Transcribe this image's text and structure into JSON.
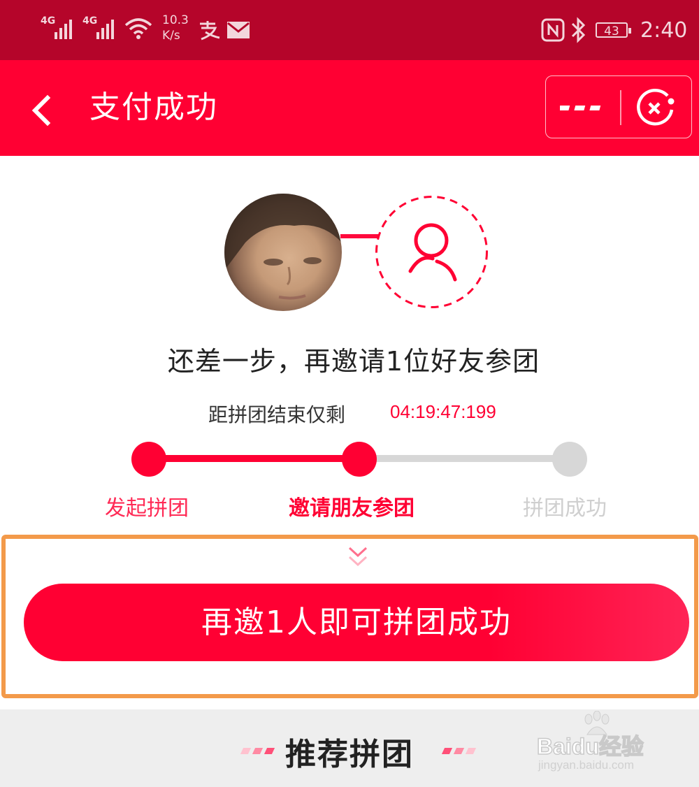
{
  "status_bar": {
    "network_1": "4G",
    "network_2": "4G",
    "speed_value": "10.3",
    "speed_unit": "K/s",
    "battery": "43",
    "time": "2:40",
    "icons": [
      "signal-icon",
      "wifi-icon",
      "alipay-icon",
      "mail-icon",
      "nfc-icon",
      "bluetooth-icon",
      "battery-icon"
    ]
  },
  "header": {
    "title": "支付成功",
    "icons": [
      "back-arrow-icon",
      "more-dots-icon",
      "close-miniapp-icon"
    ]
  },
  "group": {
    "heading": "还差一步，再邀请1位好友参团",
    "countdown_label": "距拼团结束仅剩",
    "countdown_value": "04:19:47:199",
    "icons": [
      "user-avatar",
      "empty-member-icon"
    ]
  },
  "steps": [
    {
      "label": "发起拼团",
      "state": "done"
    },
    {
      "label": "邀请朋友参团",
      "state": "current"
    },
    {
      "label": "拼团成功",
      "state": "pending"
    }
  ],
  "action": {
    "cta_label": "再邀1人即可拼团成功",
    "chevron_icon": "double-chevron-down-icon"
  },
  "recommended": {
    "title": "推荐拼团"
  },
  "watermark": {
    "brand": "Baidu经验",
    "url": "jingyan.baidu.com"
  },
  "colors": {
    "status_bar": "#b5052a",
    "primary": "#ff0033",
    "inactive": "#d7d7d7",
    "highlight_frame": "#f39a4a"
  }
}
